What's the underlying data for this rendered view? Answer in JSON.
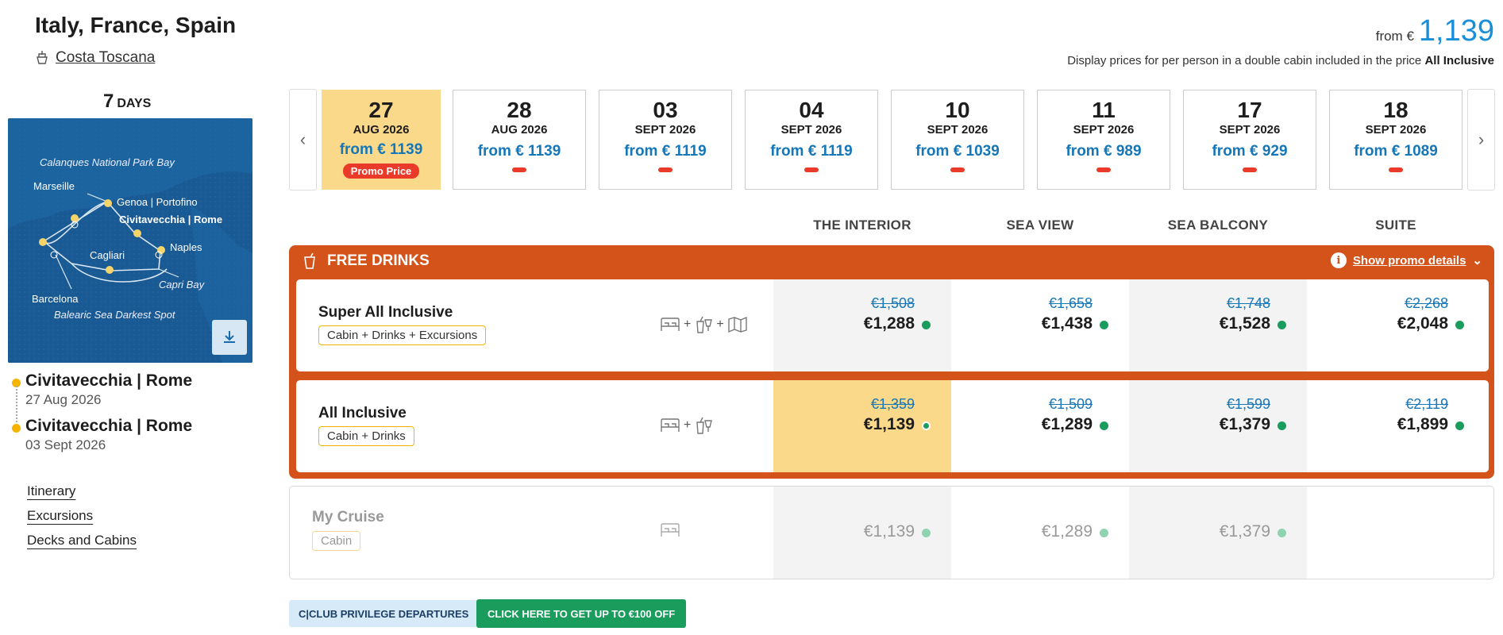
{
  "header": {
    "title": "Italy, France, Spain",
    "ship": "Costa Toscana",
    "from_label": "from €",
    "from_price": "1,139",
    "disclaimer": "Display prices for per person in a double cabin included in the price",
    "disclaimer_bold": "All Inclusive"
  },
  "left": {
    "days_num": "7",
    "days_label": "DAYS",
    "map_labels": {
      "calanques": "Calanques National Park Bay",
      "marseille": "Marseille",
      "genoa": "Genoa | Portofino",
      "civitavecchia": "Civitavecchia | Rome",
      "cagliari": "Cagliari",
      "naples": "Naples",
      "capri": "Capri Bay",
      "barcelona": "Barcelona",
      "balearic": "Balearic Sea Darkest Spot"
    },
    "departure_port": "Civitavecchia | Rome",
    "departure_date": "27 Aug 2026",
    "arrival_port": "Civitavecchia | Rome",
    "arrival_date": "03 Sept 2026",
    "links": [
      "Itinerary",
      "Excursions",
      "Decks and Cabins"
    ]
  },
  "dates": [
    {
      "day": "27",
      "month": "AUG 2026",
      "price": "from € 1139",
      "promo": "Promo Price",
      "selected": true
    },
    {
      "day": "28",
      "month": "AUG 2026",
      "price": "from € 1139"
    },
    {
      "day": "03",
      "month": "SEPT 2026",
      "price": "from € 1119"
    },
    {
      "day": "04",
      "month": "SEPT 2026",
      "price": "from € 1119"
    },
    {
      "day": "10",
      "month": "SEPT 2026",
      "price": "from € 1039"
    },
    {
      "day": "11",
      "month": "SEPT 2026",
      "price": "from € 989"
    },
    {
      "day": "17",
      "month": "SEPT 2026",
      "price": "from € 929"
    },
    {
      "day": "18",
      "month": "SEPT 2026",
      "price": "from € 1089"
    }
  ],
  "columns": [
    "THE INTERIOR",
    "SEA VIEW",
    "SEA BALCONY",
    "SUITE"
  ],
  "promo": {
    "title": "FREE DRINKS",
    "details_link": "Show promo details"
  },
  "fares": [
    {
      "name": "Super All Inclusive",
      "tag": "Cabin + Drinks + Excursions",
      "old": [
        "€1,508",
        "€1,658",
        "€1,748",
        "€2,268"
      ],
      "now": [
        "€1,288",
        "€1,438",
        "€1,528",
        "€2,048"
      ]
    },
    {
      "name": "All Inclusive",
      "tag": "Cabin + Drinks",
      "old": [
        "€1,359",
        "€1,509",
        "€1,599",
        "€2,119"
      ],
      "now": [
        "€1,139",
        "€1,289",
        "€1,379",
        "€1,899"
      ]
    },
    {
      "name": "My Cruise",
      "tag": "Cabin",
      "now": [
        "€1,139",
        "€1,289",
        "€1,379"
      ]
    }
  ],
  "buttons": {
    "cclub": "C|CLUB PRIVILEGE DEPARTURES",
    "discount": "CLICK HERE TO GET UP TO €100 OFF"
  },
  "colors": {
    "promo_orange": "#d4531a",
    "selected_yellow": "#fbd98a",
    "price_blue": "#1577b8",
    "available_green": "#1a9d5c"
  }
}
